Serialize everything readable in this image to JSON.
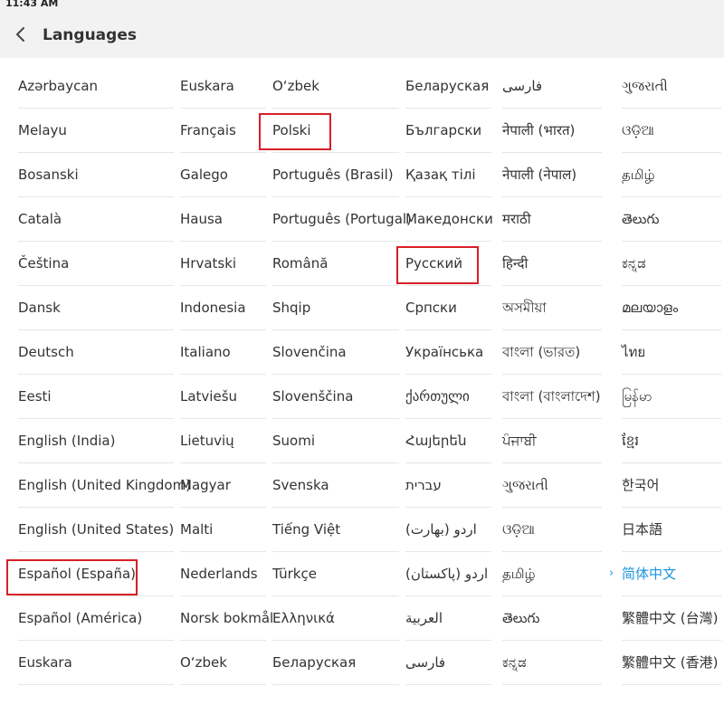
{
  "status": {
    "time": "11:43 AM"
  },
  "header": {
    "title": "Languages"
  },
  "columns": [
    [
      "Azərbaycan",
      "Melayu",
      "Bosanski",
      "Català",
      "Čeština",
      "Dansk",
      "Deutsch",
      "Eesti",
      "English (India)",
      "English (United Kingdom)",
      "English (United States)",
      "Español (España)",
      "Español (América)",
      "Euskara"
    ],
    [
      "Euskara",
      "Français",
      "Galego",
      "Hausa",
      "Hrvatski",
      "Indonesia",
      "Italiano",
      "Latviešu",
      "Lietuvių",
      "Magyar",
      "Malti",
      "Nederlands",
      "Norsk bokmål",
      "O‘zbek"
    ],
    [
      "O‘zbek",
      "Polski",
      "Português (Brasil)",
      "Português (Portugal)",
      "Română",
      "Shqip",
      "Slovenčina",
      "Slovenščina",
      "Suomi",
      "Svenska",
      "Tiếng Việt",
      "Türkçe",
      "Ελληνικά",
      "Беларуская"
    ],
    [
      "Беларуская",
      "Български",
      "Қазақ тілі",
      "Македонски",
      "Русский",
      "Српски",
      "Українська",
      "ქართული",
      "Հայերեն",
      "עברית",
      "اردو (بھارت)",
      "اردو (پاکستان)",
      "العربية",
      "فارسی"
    ],
    [
      "فارسی",
      "नेपाली (भारत)",
      "नेपाली (नेपाल)",
      "मराठी",
      "हिन्दी",
      "অসমীয়া",
      "বাংলা (ভারত)",
      "বাংলা (বাংলাদেশ)",
      "ਪੰਜਾਬੀ",
      "ગુજરાતી",
      "ଓଡ଼ିଆ",
      "தமிழ்",
      "తెలుగు",
      "ಕನ್ನಡ"
    ],
    [
      "ગુજરાતી",
      "ଓଡ଼ିଆ",
      "தமிழ்",
      "తెలుగు",
      "ಕನ್ನಡ",
      "മലയാളം",
      "ไทย",
      "မြန်မာ",
      "ខ្មែរ",
      "한국어",
      "日本語",
      "简体中文",
      "繁體中文 (台灣)",
      "繁體中文 (香港)"
    ]
  ],
  "selected": {
    "col": 5,
    "row": 11,
    "mark": "›"
  },
  "highlighted": [
    {
      "col": 2,
      "row": 1,
      "label": "Polski"
    },
    {
      "col": 3,
      "row": 4,
      "label": "Русский"
    },
    {
      "col": 0,
      "row": 11,
      "label": "Español (España)"
    }
  ],
  "colors": {
    "accent": "#1a93e0",
    "highlight": "#d81f26",
    "header_bg": "#f2f2f2",
    "divider": "#e6e6e6"
  }
}
